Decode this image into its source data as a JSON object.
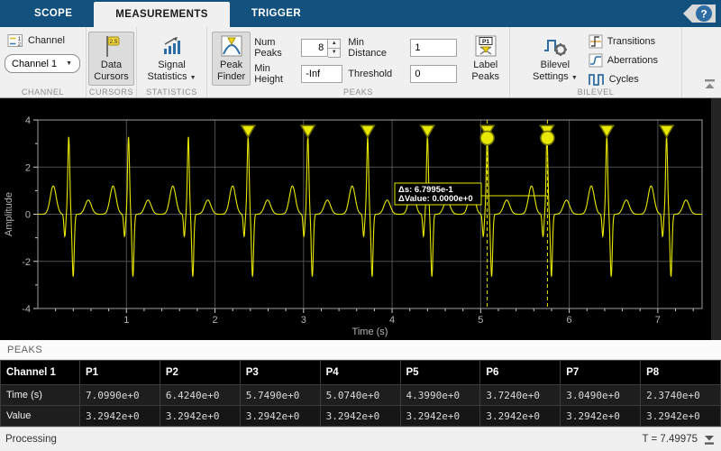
{
  "tabs": [
    {
      "label": "SCOPE",
      "active": false
    },
    {
      "label": "MEASUREMENTS",
      "active": true
    },
    {
      "label": "TRIGGER",
      "active": false
    }
  ],
  "help_label": "?",
  "ribbon": {
    "channel": {
      "group_label": "CHANNEL",
      "button_label": "Channel",
      "combo_value": "Channel 1"
    },
    "cursors": {
      "group_label": "CURSORS",
      "line1": "Data",
      "line2": "Cursors",
      "flag_value": "2.5"
    },
    "statistics": {
      "group_label": "STATISTICS",
      "line1": "Signal",
      "line2": "Statistics"
    },
    "peaks": {
      "group_label": "PEAKS",
      "peak_finder_line1": "Peak",
      "peak_finder_line2": "Finder",
      "num_peaks_label": "Num Peaks",
      "num_peaks_value": "8",
      "min_height_label": "Min Height",
      "min_height_value": "-Inf",
      "min_distance_label": "Min Distance",
      "min_distance_value": "1",
      "threshold_label": "Threshold",
      "threshold_value": "0",
      "label_peaks_line1": "Label",
      "label_peaks_line2": "Peaks",
      "label_peaks_icon_text": "P1"
    },
    "bilevel": {
      "group_label": "BILEVEL",
      "settings_line1": "Bilevel",
      "settings_line2": "Settings",
      "buttons": [
        "Transitions",
        "Aberrations",
        "Cycles"
      ]
    }
  },
  "chart_data": {
    "type": "line",
    "xlabel": "Time (s)",
    "ylabel": "Amplitude",
    "xlim": [
      0,
      7.5
    ],
    "ylim": [
      -4,
      4
    ],
    "xticks": [
      1,
      2,
      3,
      4,
      5,
      6,
      7
    ],
    "yticks": [
      -4,
      -2,
      0,
      2,
      4
    ],
    "grid": true,
    "line_color": "#e8e800",
    "grid_color": "#4f4f4f",
    "signal": "ecg-like pulse train",
    "beat_times": [
      0.349,
      1.024,
      1.699,
      2.374,
      3.049,
      3.724,
      4.399,
      5.074,
      5.749,
      6.424,
      7.099
    ],
    "beat_shape": {
      "p_amp": 1.2,
      "r_amp": 3.2942,
      "q_amp": -0.95,
      "s_amp": -2.65,
      "t_amp": 0.6
    },
    "labeled_peaks_t": [
      2.374,
      3.049,
      3.724,
      4.399,
      5.074,
      5.749,
      6.424,
      7.099
    ],
    "peak_value": 3.2942,
    "cursors": {
      "x1": 5.074,
      "x2": 5.754,
      "line1": "Δs: 6.7995e-1",
      "line2": "ΔValue: 0.0000e+0"
    }
  },
  "peaks_panel": {
    "title": "PEAKS",
    "table": {
      "header": [
        "Channel 1",
        "P1",
        "P2",
        "P3",
        "P4",
        "P5",
        "P6",
        "P7",
        "P8"
      ],
      "rows": [
        {
          "label": "Time (s)",
          "values": [
            "7.0990e+0",
            "6.4240e+0",
            "5.7490e+0",
            "5.0740e+0",
            "4.3990e+0",
            "3.7240e+0",
            "3.0490e+0",
            "2.3740e+0"
          ]
        },
        {
          "label": "Value",
          "values": [
            "3.2942e+0",
            "3.2942e+0",
            "3.2942e+0",
            "3.2942e+0",
            "3.2942e+0",
            "3.2942e+0",
            "3.2942e+0",
            "3.2942e+0"
          ]
        }
      ]
    }
  },
  "status_bar": {
    "left": "Processing",
    "right": "T = 7.49975"
  }
}
